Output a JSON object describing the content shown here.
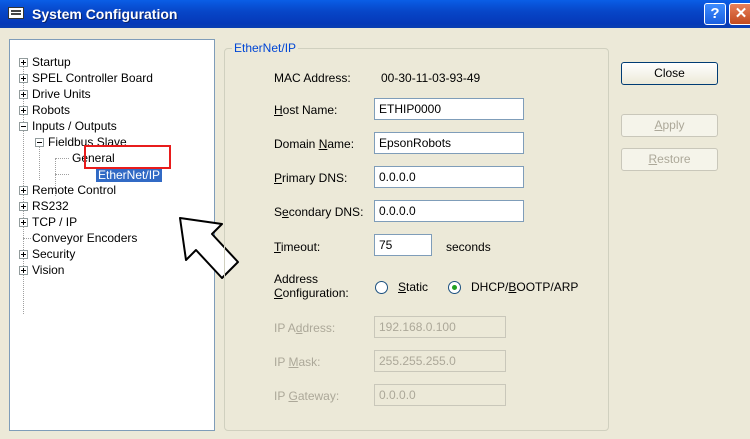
{
  "window": {
    "title": "System Configuration",
    "help_glyph": "?",
    "close_glyph": "✕"
  },
  "tree": {
    "startup": "Startup",
    "spel_board": "SPEL Controller Board",
    "drive_units": "Drive Units",
    "robots": "Robots",
    "inputs_outputs": "Inputs / Outputs",
    "fieldbus_slave": "Fieldbus Slave",
    "general": "General",
    "ethernet_ip": "EtherNet/IP",
    "remote_control": "Remote Control",
    "rs232": "RS232",
    "tcp_ip": "TCP / IP",
    "conveyor_encoders": "Conveyor Encoders",
    "security": "Security",
    "vision": "Vision"
  },
  "group": {
    "title": "EtherNet/IP"
  },
  "form": {
    "mac_label": "MAC Address:",
    "mac_value": "00-30-11-03-93-49",
    "host_label_u": "H",
    "host_label_rest": "ost Name:",
    "host_value": "ETHIP0000",
    "domain_label_a": "Domain ",
    "domain_label_u": "N",
    "domain_label_b": "ame:",
    "domain_value": "EpsonRobots",
    "pdns_label_u": "P",
    "pdns_label_rest": "rimary DNS:",
    "pdns_value": "0.0.0.0",
    "sdns_label_a": "S",
    "sdns_label_u": "e",
    "sdns_label_b": "condary DNS:",
    "sdns_value": "0.0.0.0",
    "timeout_label_u": "T",
    "timeout_label_rest": "imeout:",
    "timeout_value": "75",
    "timeout_unit": "seconds",
    "addr_label_1": "Address",
    "addr_label_2_u": "C",
    "addr_label_2_rest": "onfiguration:",
    "static_u": "S",
    "static_rest": "tatic",
    "dhcp_a": "DHCP/",
    "dhcp_u": "B",
    "dhcp_b": "OOTP/ARP",
    "ip_label_a": "IP A",
    "ip_label_u": "d",
    "ip_label_b": "dress:",
    "ip_value": "192.168.0.100",
    "mask_label_a": "IP ",
    "mask_label_u": "M",
    "mask_label_b": "ask:",
    "mask_value": "255.255.255.0",
    "gw_label_a": "IP ",
    "gw_label_u": "G",
    "gw_label_b": "ateway:",
    "gw_value": "0.0.0.0",
    "address_mode": "DHCP/BOOTP/ARP"
  },
  "buttons": {
    "close": "Close",
    "apply_u": "A",
    "apply_rest": "pply",
    "restore_u": "R",
    "restore_rest": "estore"
  }
}
